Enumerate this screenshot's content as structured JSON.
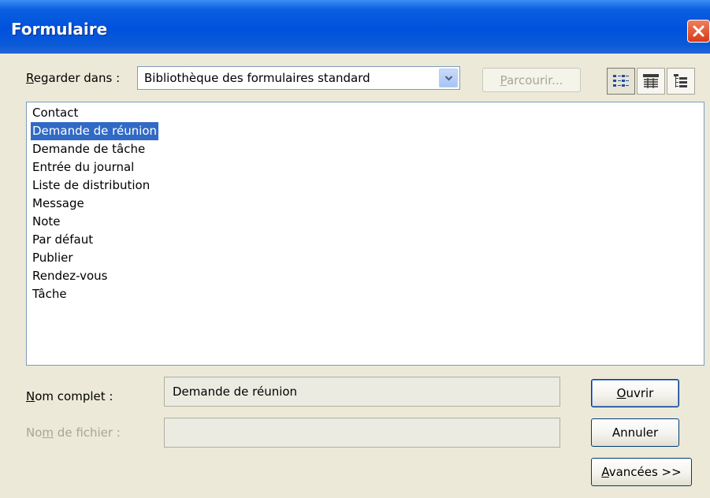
{
  "dialog": {
    "title": "Formulaire"
  },
  "look_in": {
    "label_key": "R",
    "label_rest": "egarder dans :",
    "selected_value": "Bibliothèque des formulaires standard",
    "browse_button_key": "P",
    "browse_button_rest": "arcourir..."
  },
  "view_buttons": [
    {
      "name": "list-view-icon",
      "pressed": true
    },
    {
      "name": "details-view-icon",
      "pressed": false
    },
    {
      "name": "tree-view-icon",
      "pressed": false
    }
  ],
  "forms_list": {
    "items": [
      "Contact",
      "Demande de réunion",
      "Demande de tâche",
      "Entrée du journal",
      "Liste de distribution",
      "Message",
      "Note",
      "Par défaut",
      "Publier",
      "Rendez-vous",
      "Tâche"
    ],
    "selected_index": 1
  },
  "display_name": {
    "label_key": "N",
    "label_rest": "om complet :",
    "value": "Demande de réunion"
  },
  "file_name": {
    "label_pre": "No",
    "label_key": "m",
    "label_rest": " de fichier :",
    "value": ""
  },
  "buttons": {
    "open_key": "O",
    "open_rest": "uvrir",
    "cancel": "Annuler",
    "advanced_key": "A",
    "advanced_rest": "vancées >>"
  },
  "colors": {
    "selection": "#316ac5",
    "titlebar": "#0051dc",
    "dialog_bg": "#ece9d8"
  }
}
